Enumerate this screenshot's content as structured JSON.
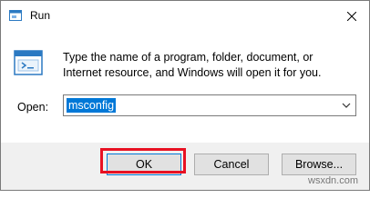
{
  "window": {
    "title": "Run"
  },
  "description": "Type the name of a program, folder, document, or Internet resource, and Windows will open it for you.",
  "open": {
    "label": "Open:",
    "value": "msconfig"
  },
  "buttons": {
    "ok": "OK",
    "cancel": "Cancel",
    "browse": "Browse..."
  },
  "watermark": "wsxdn.com",
  "colors": {
    "selection": "#0078d7",
    "highlight_box": "#e81123",
    "footer_bg": "#f0f0f0"
  },
  "icons": {
    "app": "run-dialog-icon",
    "close": "close-icon",
    "dropdown": "chevron-down-icon"
  }
}
